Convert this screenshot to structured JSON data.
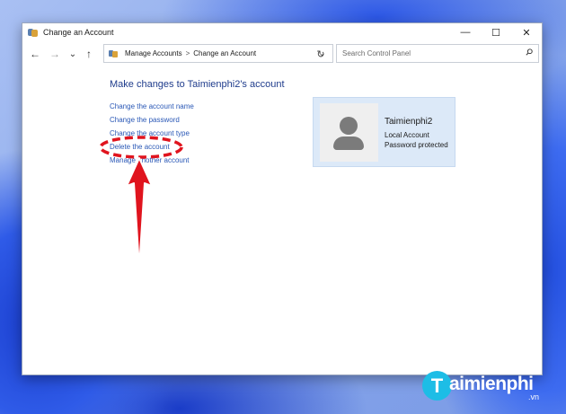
{
  "window": {
    "title": "Change an Account",
    "controls": {
      "minimize": "—",
      "maximize": "☐",
      "close": "✕"
    }
  },
  "nav": {
    "back": "←",
    "forward": "→",
    "recent": "⌄",
    "up": "↑",
    "refresh": "↻"
  },
  "address": {
    "root": "Manage Accounts",
    "separator": ">",
    "current": "Change an Account",
    "dropdown": "⌄"
  },
  "search": {
    "placeholder": "Search Control Panel"
  },
  "main": {
    "heading": "Make changes to Taimienphi2's account",
    "links": [
      "Change the account name",
      "Change the password",
      "Change the account type",
      "Delete the account",
      "Manage another account"
    ]
  },
  "account": {
    "name": "Taimienphi2",
    "type": "Local Account",
    "status": "Password protected"
  },
  "annotation": {
    "color": "#e0141e"
  },
  "watermark": {
    "letter": "T",
    "brand": "aimienphi",
    "tld": ".vn"
  }
}
